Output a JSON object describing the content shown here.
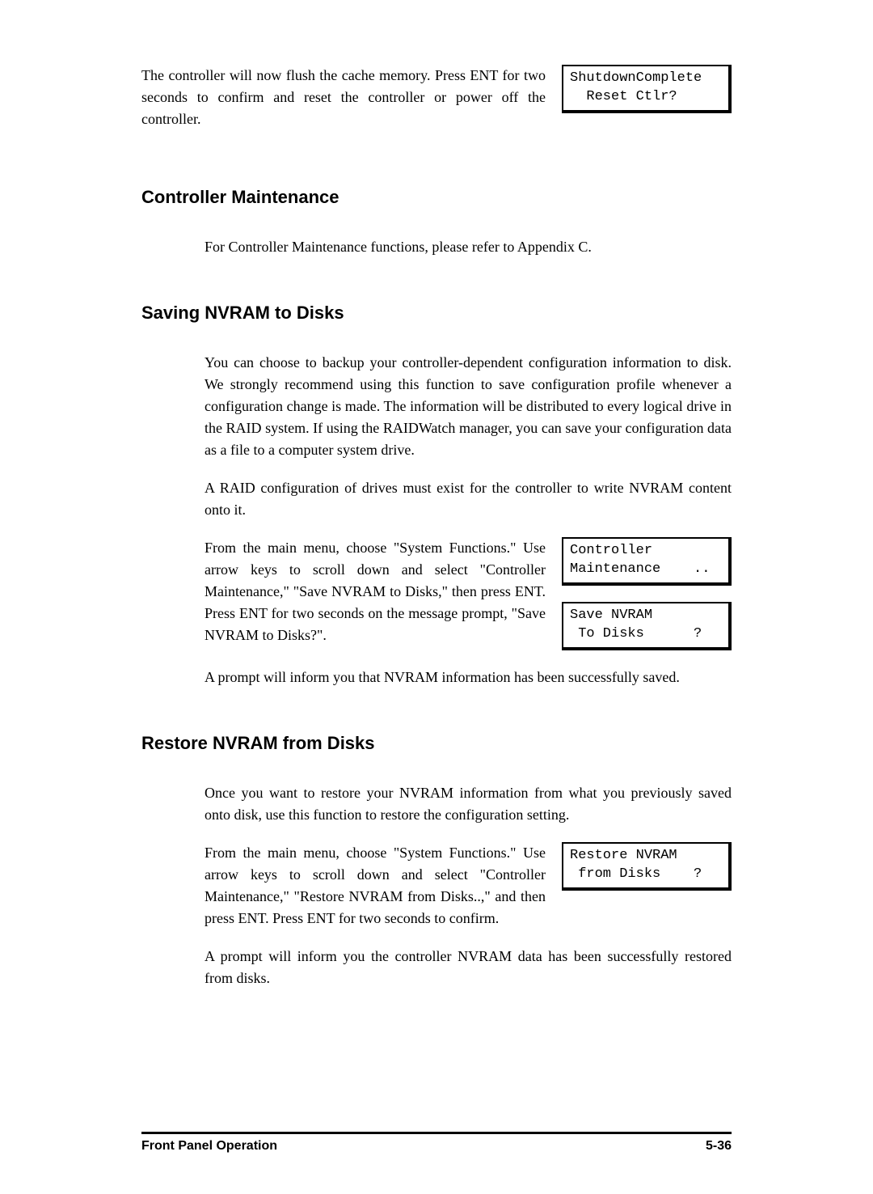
{
  "intro": {
    "text": "The controller will now flush the cache memory.  Press ENT for two seconds to confirm and reset the controller or power off the controller.",
    "lcd": "ShutdownComplete\n  Reset Ctlr?"
  },
  "section1": {
    "heading": "Controller Maintenance",
    "text": "For Controller Maintenance functions, please refer to Appendix C."
  },
  "section2": {
    "heading": "Saving NVRAM to Disks",
    "para1": "You can choose to backup your controller-dependent configuration information to disk.  We strongly recommend using this function to save configuration profile whenever a configuration change is made.  The information will be distributed to every logical drive in the RAID system.  If using the RAIDWatch manager, you can save your configuration data as a file to a computer system drive.",
    "para2": "A RAID configuration of drives must exist for the controller to write NVRAM content onto it.",
    "para3": "From the main menu, choose \"System Functions.\"  Use arrow keys to scroll down and select \"Controller Maintenance,\" \"Save NVRAM to Disks,\" then press ENT.  Press ENT for two seconds on the message prompt, \"Save NVRAM to Disks?\".",
    "lcd1": "Controller\nMaintenance    ..",
    "lcd2": "Save NVRAM\n To Disks      ?",
    "para4": "A prompt will inform you that NVRAM information has been successfully saved."
  },
  "section3": {
    "heading": "Restore NVRAM from Disks",
    "para1": "Once you want to restore your NVRAM information from what you previously saved onto disk, use this function to restore the configuration setting.",
    "para2": "From the main menu, choose \"System Functions.\"  Use arrow keys to scroll down and select \"Controller Maintenance,\" \"Restore NVRAM from Disks..,\" and then press ENT.  Press ENT for two seconds to confirm.",
    "lcd1": "Restore NVRAM\n from Disks    ?",
    "para3": "A prompt will inform you the controller NVRAM data has been successfully restored from disks."
  },
  "footer": {
    "left": "Front Panel Operation",
    "right": "5-36"
  }
}
